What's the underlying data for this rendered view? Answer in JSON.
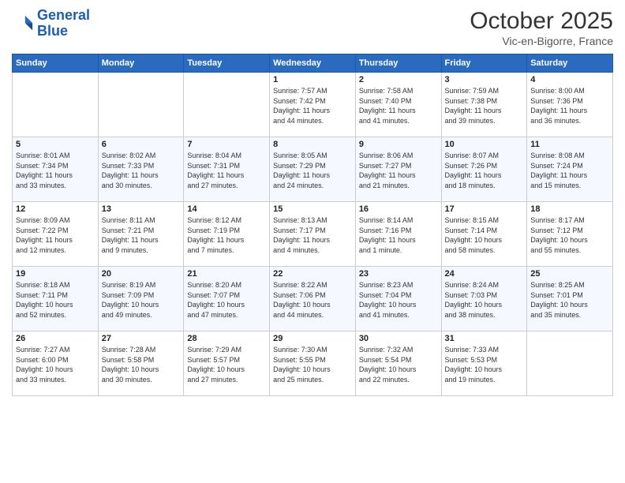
{
  "header": {
    "logo_line1": "General",
    "logo_line2": "Blue",
    "month": "October 2025",
    "location": "Vic-en-Bigorre, France"
  },
  "days_of_week": [
    "Sunday",
    "Monday",
    "Tuesday",
    "Wednesday",
    "Thursday",
    "Friday",
    "Saturday"
  ],
  "weeks": [
    [
      {
        "day": "",
        "info": ""
      },
      {
        "day": "",
        "info": ""
      },
      {
        "day": "",
        "info": ""
      },
      {
        "day": "1",
        "info": "Sunrise: 7:57 AM\nSunset: 7:42 PM\nDaylight: 11 hours\nand 44 minutes."
      },
      {
        "day": "2",
        "info": "Sunrise: 7:58 AM\nSunset: 7:40 PM\nDaylight: 11 hours\nand 41 minutes."
      },
      {
        "day": "3",
        "info": "Sunrise: 7:59 AM\nSunset: 7:38 PM\nDaylight: 11 hours\nand 39 minutes."
      },
      {
        "day": "4",
        "info": "Sunrise: 8:00 AM\nSunset: 7:36 PM\nDaylight: 11 hours\nand 36 minutes."
      }
    ],
    [
      {
        "day": "5",
        "info": "Sunrise: 8:01 AM\nSunset: 7:34 PM\nDaylight: 11 hours\nand 33 minutes."
      },
      {
        "day": "6",
        "info": "Sunrise: 8:02 AM\nSunset: 7:33 PM\nDaylight: 11 hours\nand 30 minutes."
      },
      {
        "day": "7",
        "info": "Sunrise: 8:04 AM\nSunset: 7:31 PM\nDaylight: 11 hours\nand 27 minutes."
      },
      {
        "day": "8",
        "info": "Sunrise: 8:05 AM\nSunset: 7:29 PM\nDaylight: 11 hours\nand 24 minutes."
      },
      {
        "day": "9",
        "info": "Sunrise: 8:06 AM\nSunset: 7:27 PM\nDaylight: 11 hours\nand 21 minutes."
      },
      {
        "day": "10",
        "info": "Sunrise: 8:07 AM\nSunset: 7:26 PM\nDaylight: 11 hours\nand 18 minutes."
      },
      {
        "day": "11",
        "info": "Sunrise: 8:08 AM\nSunset: 7:24 PM\nDaylight: 11 hours\nand 15 minutes."
      }
    ],
    [
      {
        "day": "12",
        "info": "Sunrise: 8:09 AM\nSunset: 7:22 PM\nDaylight: 11 hours\nand 12 minutes."
      },
      {
        "day": "13",
        "info": "Sunrise: 8:11 AM\nSunset: 7:21 PM\nDaylight: 11 hours\nand 9 minutes."
      },
      {
        "day": "14",
        "info": "Sunrise: 8:12 AM\nSunset: 7:19 PM\nDaylight: 11 hours\nand 7 minutes."
      },
      {
        "day": "15",
        "info": "Sunrise: 8:13 AM\nSunset: 7:17 PM\nDaylight: 11 hours\nand 4 minutes."
      },
      {
        "day": "16",
        "info": "Sunrise: 8:14 AM\nSunset: 7:16 PM\nDaylight: 11 hours\nand 1 minute."
      },
      {
        "day": "17",
        "info": "Sunrise: 8:15 AM\nSunset: 7:14 PM\nDaylight: 10 hours\nand 58 minutes."
      },
      {
        "day": "18",
        "info": "Sunrise: 8:17 AM\nSunset: 7:12 PM\nDaylight: 10 hours\nand 55 minutes."
      }
    ],
    [
      {
        "day": "19",
        "info": "Sunrise: 8:18 AM\nSunset: 7:11 PM\nDaylight: 10 hours\nand 52 minutes."
      },
      {
        "day": "20",
        "info": "Sunrise: 8:19 AM\nSunset: 7:09 PM\nDaylight: 10 hours\nand 49 minutes."
      },
      {
        "day": "21",
        "info": "Sunrise: 8:20 AM\nSunset: 7:07 PM\nDaylight: 10 hours\nand 47 minutes."
      },
      {
        "day": "22",
        "info": "Sunrise: 8:22 AM\nSunset: 7:06 PM\nDaylight: 10 hours\nand 44 minutes."
      },
      {
        "day": "23",
        "info": "Sunrise: 8:23 AM\nSunset: 7:04 PM\nDaylight: 10 hours\nand 41 minutes."
      },
      {
        "day": "24",
        "info": "Sunrise: 8:24 AM\nSunset: 7:03 PM\nDaylight: 10 hours\nand 38 minutes."
      },
      {
        "day": "25",
        "info": "Sunrise: 8:25 AM\nSunset: 7:01 PM\nDaylight: 10 hours\nand 35 minutes."
      }
    ],
    [
      {
        "day": "26",
        "info": "Sunrise: 7:27 AM\nSunset: 6:00 PM\nDaylight: 10 hours\nand 33 minutes."
      },
      {
        "day": "27",
        "info": "Sunrise: 7:28 AM\nSunset: 5:58 PM\nDaylight: 10 hours\nand 30 minutes."
      },
      {
        "day": "28",
        "info": "Sunrise: 7:29 AM\nSunset: 5:57 PM\nDaylight: 10 hours\nand 27 minutes."
      },
      {
        "day": "29",
        "info": "Sunrise: 7:30 AM\nSunset: 5:55 PM\nDaylight: 10 hours\nand 25 minutes."
      },
      {
        "day": "30",
        "info": "Sunrise: 7:32 AM\nSunset: 5:54 PM\nDaylight: 10 hours\nand 22 minutes."
      },
      {
        "day": "31",
        "info": "Sunrise: 7:33 AM\nSunset: 5:53 PM\nDaylight: 10 hours\nand 19 minutes."
      },
      {
        "day": "",
        "info": ""
      }
    ]
  ]
}
